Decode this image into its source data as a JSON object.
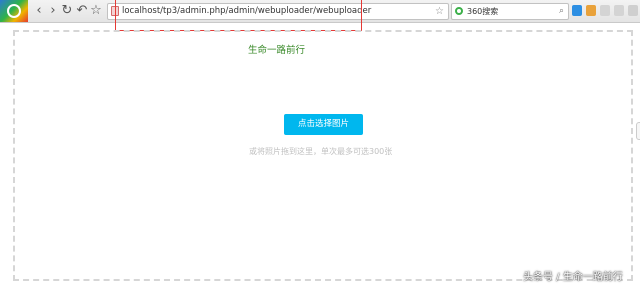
{
  "browser": {
    "address_bar": {
      "url": "localhost/tp3/admin.php/admin/webuploader/webuploader"
    },
    "search_box": {
      "query": "360搜索"
    },
    "icons": [
      "browser-logo-icon",
      "back-icon",
      "forward-icon",
      "reload-icon",
      "undo-icon",
      "star-icon",
      "lock-icon",
      "search-icon"
    ]
  },
  "page": {
    "title": "生命一路前行",
    "pick_button": "点击选择图片",
    "hint": "或将照片拖到这里，单次最多可选300张"
  },
  "watermark": "头条号 / 生命一路前行",
  "colors": {
    "accent": "#00b7ee",
    "title": "#3a8a2a",
    "highlight_box": "#e53935"
  }
}
